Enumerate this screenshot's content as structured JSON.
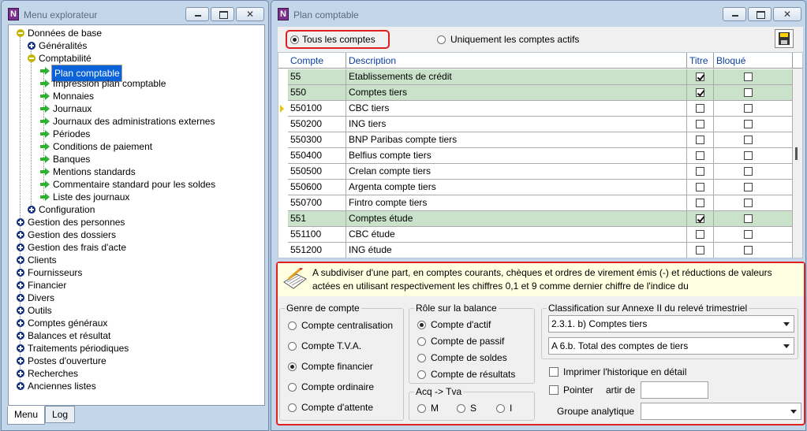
{
  "left_window": {
    "title": "Menu explorateur",
    "tree": [
      {
        "label": "Données de base",
        "icon": "minus",
        "level": 0
      },
      {
        "label": "Généralités",
        "icon": "plus",
        "level": 1
      },
      {
        "label": "Comptabilité",
        "icon": "minus",
        "level": 1
      },
      {
        "label": "Plan comptable",
        "icon": "arrow",
        "level": 2,
        "selected": true
      },
      {
        "label": "Impression plan comptable",
        "icon": "arrow",
        "level": 2
      },
      {
        "label": "Monnaies",
        "icon": "arrow",
        "level": 2
      },
      {
        "label": "Journaux",
        "icon": "arrow",
        "level": 2
      },
      {
        "label": "Journaux des administrations externes",
        "icon": "arrow",
        "level": 2
      },
      {
        "label": "Périodes",
        "icon": "arrow",
        "level": 2
      },
      {
        "label": "Conditions de paiement",
        "icon": "arrow",
        "level": 2
      },
      {
        "label": "Banques",
        "icon": "arrow",
        "level": 2
      },
      {
        "label": "Mentions standards",
        "icon": "arrow",
        "level": 2
      },
      {
        "label": "Commentaire standard pour les soldes",
        "icon": "arrow",
        "level": 2
      },
      {
        "label": "Liste des journaux",
        "icon": "arrow",
        "level": 2
      },
      {
        "label": "Configuration",
        "icon": "plus",
        "level": 1
      },
      {
        "label": "Gestion des personnes",
        "icon": "plus",
        "level": 0
      },
      {
        "label": "Gestion des dossiers",
        "icon": "plus",
        "level": 0
      },
      {
        "label": "Gestion des frais d'acte",
        "icon": "plus",
        "level": 0
      },
      {
        "label": "Clients",
        "icon": "plus",
        "level": 0
      },
      {
        "label": "Fournisseurs",
        "icon": "plus",
        "level": 0
      },
      {
        "label": "Financier",
        "icon": "plus",
        "level": 0
      },
      {
        "label": "Divers",
        "icon": "plus",
        "level": 0
      },
      {
        "label": "Outils",
        "icon": "plus",
        "level": 0
      },
      {
        "label": "Comptes généraux",
        "icon": "plus",
        "level": 0
      },
      {
        "label": "Balances et résultat",
        "icon": "plus",
        "level": 0
      },
      {
        "label": "Traitements périodiques",
        "icon": "plus",
        "level": 0
      },
      {
        "label": "Postes d'ouverture",
        "icon": "plus",
        "level": 0
      },
      {
        "label": "Recherches",
        "icon": "plus",
        "level": 0
      },
      {
        "label": "Anciennes listes",
        "icon": "plus",
        "level": 0
      }
    ],
    "tabs": [
      {
        "label": "Menu",
        "active": true
      },
      {
        "label": "Log",
        "active": false
      }
    ]
  },
  "right_window": {
    "title": "Plan comptable",
    "filter": {
      "all_label": "Tous les comptes",
      "active_label": "Uniquement les comptes actifs",
      "selected": "all"
    },
    "grid": {
      "columns": [
        "Compte",
        "Description",
        "Titre",
        "Bloqué"
      ],
      "rows": [
        {
          "compte": "55",
          "description": "Etablissements de crédit",
          "titre": true,
          "bloque": false,
          "green": true,
          "current": false
        },
        {
          "compte": "550",
          "description": "Comptes tiers",
          "titre": true,
          "bloque": false,
          "green": true,
          "current": false
        },
        {
          "compte": "550100",
          "description": "CBC tiers",
          "titre": false,
          "bloque": false,
          "green": false,
          "current": true
        },
        {
          "compte": "550200",
          "description": "ING tiers",
          "titre": false,
          "bloque": false,
          "green": false,
          "current": false
        },
        {
          "compte": "550300",
          "description": "BNP Paribas compte tiers",
          "titre": false,
          "bloque": false,
          "green": false,
          "current": false
        },
        {
          "compte": "550400",
          "description": "Belfius compte tiers",
          "titre": false,
          "bloque": false,
          "green": false,
          "current": false
        },
        {
          "compte": "550500",
          "description": "Crelan compte tiers",
          "titre": false,
          "bloque": false,
          "green": false,
          "current": false
        },
        {
          "compte": "550600",
          "description": "Argenta compte tiers",
          "titre": false,
          "bloque": false,
          "green": false,
          "current": false
        },
        {
          "compte": "550700",
          "description": "Fintro compte tiers",
          "titre": false,
          "bloque": false,
          "green": false,
          "current": false
        },
        {
          "compte": "551",
          "description": "Comptes étude",
          "titre": true,
          "bloque": false,
          "green": true,
          "current": false
        },
        {
          "compte": "551100",
          "description": "CBC étude",
          "titre": false,
          "bloque": false,
          "green": false,
          "current": false
        },
        {
          "compte": "551200",
          "description": "ING étude",
          "titre": false,
          "bloque": false,
          "green": false,
          "current": false
        }
      ]
    },
    "note": "A subdiviser d'une part, en comptes courants, chèques et ordres de virement émis (-) et réductions de valeurs actées en utilisant respectivement les chiffres 0,1 et 9 comme dernier chiffre de l'indice du",
    "genre": {
      "legend": "Genre de compte",
      "options": [
        "Compte centralisation",
        "Compte T.V.A.",
        "Compte financier",
        "Compte ordinaire",
        "Compte d'attente"
      ],
      "selected": 2
    },
    "role": {
      "legend": "Rôle sur la balance",
      "options": [
        "Compte d'actif",
        "Compte de passif",
        "Compte de soldes",
        "Compte de résultats"
      ],
      "selected": 0
    },
    "acq": {
      "legend": "Acq -> Tva",
      "options": [
        "M",
        "S",
        "I"
      ],
      "selected": -1
    },
    "classification": {
      "legend": "Classification sur Annexe II du relevé trimestriel",
      "select1": "2.3.1. b) Comptes tiers",
      "select2": "A 6.b. Total des comptes de tiers"
    },
    "imprimer_label": "Imprimer l'historique en détail",
    "pointer_label": "Pointer",
    "artir_label": "artir de",
    "groupe_label": "Groupe analytique",
    "colors": {
      "accent_red": "#e02020",
      "selection": "#0a63d8",
      "green_row": "#c9e2c9",
      "note_bg": "#ffffe1"
    }
  }
}
